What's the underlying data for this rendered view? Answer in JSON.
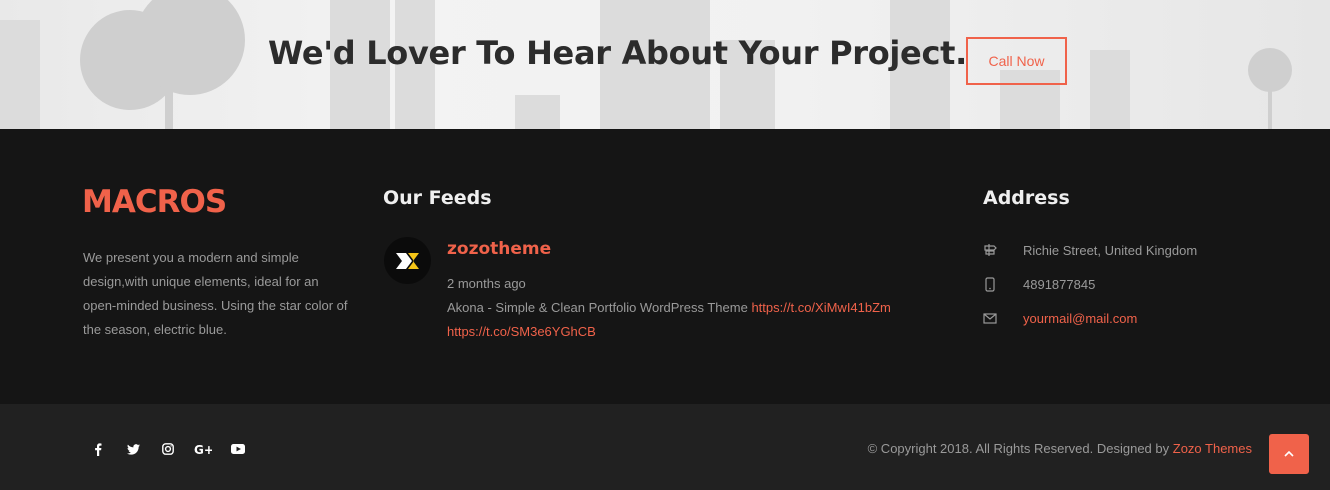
{
  "cta": {
    "title": "We'd Lover To Hear About Your Project.",
    "button_label": "Call Now"
  },
  "about": {
    "logo": "MACROS",
    "description": "We present you a modern and simple design,with unique elements, ideal for an open-minded business. Using the star color of the season, electric blue."
  },
  "feeds": {
    "heading": "Our Feeds",
    "username": "zozotheme",
    "time": "2 months ago",
    "text": "Akona - Simple & Clean Portfolio WordPress Theme",
    "link1": "https://t.co/XiMwI41bZm",
    "link2": "https://t.co/SM3e6YGhCB"
  },
  "address": {
    "heading": "Address",
    "street": "Richie Street, United Kingdom",
    "phone": "4891877845",
    "email": "yourmail@mail.com"
  },
  "bottom": {
    "socials": [
      "facebook-icon",
      "twitter-icon",
      "instagram-icon",
      "google-plus-icon",
      "youtube-icon"
    ],
    "copyright_prefix": "© Copyright 2018. All Rights Reserved. Designed by",
    "copyright_brand": "Zozo Themes"
  },
  "colors": {
    "accent": "#f0624a",
    "footer_bg": "#151515",
    "bottom_bg": "#212121"
  }
}
